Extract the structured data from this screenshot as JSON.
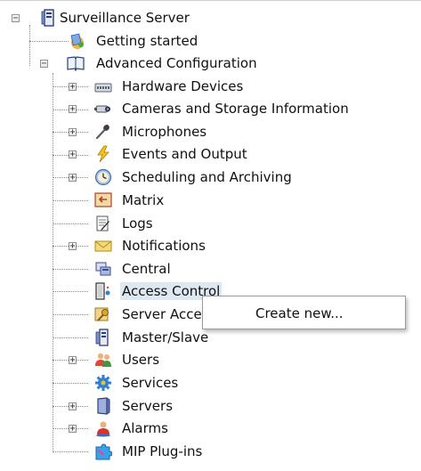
{
  "tree": {
    "root": "Surveillance Server",
    "getting_started": "Getting started",
    "advanced": "Advanced Configuration",
    "hardware": "Hardware Devices",
    "cameras": "Cameras and Storage Information",
    "microphones": "Microphones",
    "events": "Events and Output",
    "scheduling": "Scheduling and Archiving",
    "matrix": "Matrix",
    "logs": "Logs",
    "notifications": "Notifications",
    "central": "Central",
    "access_control": "Access Control",
    "server_access": "Server Access",
    "master_slave": "Master/Slave",
    "users": "Users",
    "services": "Services",
    "servers": "Servers",
    "alarms": "Alarms",
    "mip": "MIP Plug-ins"
  },
  "context_menu": {
    "create_new": "Create new..."
  },
  "expander_symbols": {
    "collapsed": "+",
    "expanded": "−"
  },
  "icons": {
    "root": "server-icon",
    "getting_started": "getting-started-icon",
    "advanced": "book-icon",
    "hardware": "hardware-device-icon",
    "cameras": "camera-icon",
    "microphones": "microphone-icon",
    "events": "lightning-icon",
    "scheduling": "clock-icon",
    "matrix": "matrix-icon",
    "logs": "log-icon",
    "notifications": "envelope-icon",
    "central": "central-icon",
    "access_control": "access-control-icon",
    "server_access": "key-icon",
    "master_slave": "master-slave-icon",
    "users": "users-icon",
    "services": "gear-icon",
    "servers": "servers-icon",
    "alarms": "alarm-icon",
    "mip": "puzzle-icon"
  },
  "colors": {
    "selection": "#dde8f3",
    "menu_border": "#9a9a9a"
  }
}
